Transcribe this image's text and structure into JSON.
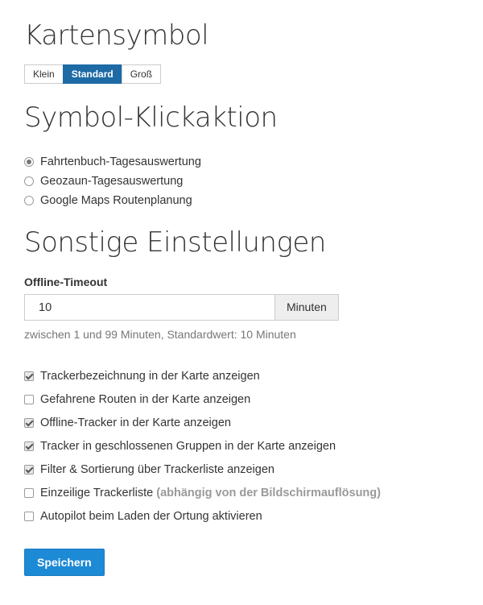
{
  "map_symbol": {
    "title": "Kartensymbol",
    "options": [
      "Klein",
      "Standard",
      "Groß"
    ],
    "selected": "Standard"
  },
  "click_action": {
    "title": "Symbol-Klickaktion",
    "options": [
      {
        "label": "Fahrtenbuch-Tagesauswertung",
        "checked": true
      },
      {
        "label": "Geozaun-Tagesauswertung",
        "checked": false
      },
      {
        "label": "Google Maps Routenplanung",
        "checked": false
      }
    ]
  },
  "other": {
    "title": "Sonstige Einstellungen",
    "offline_timeout": {
      "label": "Offline-Timeout",
      "value": "10",
      "unit": "Minuten",
      "help": "zwischen 1 und 99 Minuten, Standardwert: 10 Minuten"
    },
    "checkboxes": [
      {
        "label": "Trackerbezeichnung in der Karte anzeigen",
        "checked": true,
        "hint": ""
      },
      {
        "label": "Gefahrene Routen in der Karte anzeigen",
        "checked": false,
        "hint": ""
      },
      {
        "label": "Offline-Tracker in der Karte anzeigen",
        "checked": true,
        "hint": ""
      },
      {
        "label": "Tracker in geschlossenen Gruppen in der Karte anzeigen",
        "checked": true,
        "hint": ""
      },
      {
        "label": "Filter & Sortierung über Trackerliste anzeigen",
        "checked": true,
        "hint": ""
      },
      {
        "label": "Einzeilige Trackerliste",
        "checked": false,
        "hint": "(abhängig von der Bildschirmauflösung)"
      },
      {
        "label": "Autopilot beim Laden der Ortung aktivieren",
        "checked": false,
        "hint": ""
      }
    ]
  },
  "save_label": "Speichern",
  "colors": {
    "primary": "#1d6aa5",
    "save": "#1d8ad6",
    "hint": "#9a9a9a"
  }
}
